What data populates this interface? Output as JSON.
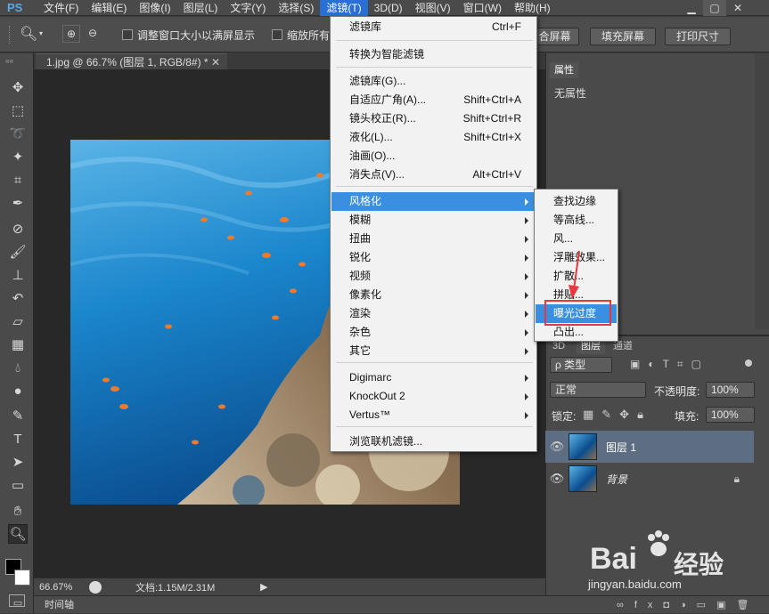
{
  "app": {
    "logo": "PS"
  },
  "menubar": {
    "items": [
      "文件(F)",
      "编辑(E)",
      "图像(I)",
      "图层(L)",
      "文字(Y)",
      "选择(S)",
      "滤镜(T)",
      "3D(D)",
      "视图(V)",
      "窗口(W)",
      "帮助(H)"
    ],
    "active_index": 6
  },
  "options": {
    "resize_window_label": "调整窗口大小以满屏显示",
    "zoom_all_label": "缩放所有",
    "fit_screen_label": "合屏幕",
    "fill_screen_label": "填充屏幕",
    "print_size_label": "打印尺寸"
  },
  "document": {
    "tab_title": "1.jpg @ 66.7% (图层 1, RGB/8#) *",
    "zoom": "66.67%",
    "doc_info": "文档:1.15M/2.31M",
    "timeline_label": "时间轴"
  },
  "filter_menu": {
    "items": [
      {
        "label": "滤镜库",
        "shortcut": "Ctrl+F"
      },
      {
        "label": "转换为智能滤镜",
        "shortcut": ""
      },
      {
        "label": "滤镜库(G)...",
        "shortcut": ""
      },
      {
        "label": "自适应广角(A)...",
        "shortcut": "Shift+Ctrl+A"
      },
      {
        "label": "镜头校正(R)...",
        "shortcut": "Shift+Ctrl+R"
      },
      {
        "label": "液化(L)...",
        "shortcut": "Shift+Ctrl+X"
      },
      {
        "label": "油画(O)...",
        "shortcut": ""
      },
      {
        "label": "消失点(V)...",
        "shortcut": "Alt+Ctrl+V"
      },
      {
        "label": "风格化",
        "shortcut": ""
      },
      {
        "label": "模糊",
        "shortcut": ""
      },
      {
        "label": "扭曲",
        "shortcut": ""
      },
      {
        "label": "锐化",
        "shortcut": ""
      },
      {
        "label": "视频",
        "shortcut": ""
      },
      {
        "label": "像素化",
        "shortcut": ""
      },
      {
        "label": "渲染",
        "shortcut": ""
      },
      {
        "label": "杂色",
        "shortcut": ""
      },
      {
        "label": "其它",
        "shortcut": ""
      },
      {
        "label": "Digimarc",
        "shortcut": ""
      },
      {
        "label": "KnockOut 2",
        "shortcut": ""
      },
      {
        "label": "Vertus™",
        "shortcut": ""
      },
      {
        "label": "浏览联机滤镜...",
        "shortcut": ""
      }
    ]
  },
  "stylize_submenu": {
    "items": [
      "查找边缘",
      "等高线...",
      "风...",
      "浮雕效果...",
      "扩散...",
      "拼贴...",
      "曝光过度",
      "凸出..."
    ],
    "highlighted_index": 6
  },
  "properties_panel": {
    "tab_label": "属性",
    "content": "无属性"
  },
  "layers_panel": {
    "tabs": [
      "3D",
      "图层",
      "通道"
    ],
    "filter_type": "类型",
    "blend_mode": "正常",
    "opacity_label": "不透明度:",
    "opacity_value": "100%",
    "lock_label": "锁定:",
    "fill_label": "填充:",
    "fill_value": "100%",
    "layers": [
      {
        "name": "图层 1",
        "selected": true
      },
      {
        "name": "背景",
        "selected": false
      }
    ]
  },
  "watermark": {
    "brand": "Bai",
    "brand2": "经验",
    "url": "jingyan.baidu.com"
  },
  "colors": {
    "accent": "#3b8fe0",
    "highlight_box": "#e8383d",
    "panel_bg": "#4a4a4a"
  }
}
